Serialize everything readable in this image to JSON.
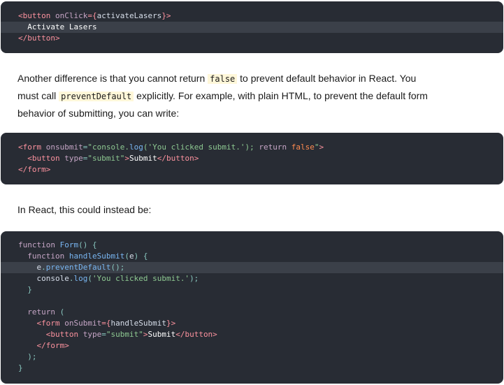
{
  "block1": {
    "lines": [
      [
        [
          "tok-tag",
          "<button "
        ],
        [
          "tok-attr",
          "onClick"
        ],
        [
          "tok-tag",
          "={"
        ],
        [
          "tok-var",
          "activateLasers"
        ],
        [
          "tok-tag",
          "}>"
        ]
      ],
      [
        [
          "tok-text",
          "  Activate Lasers"
        ]
      ],
      [
        [
          "tok-tag",
          "</button>"
        ]
      ]
    ]
  },
  "para1": {
    "t1": "Another difference is that you cannot return ",
    "c1": "false",
    "t2": " to prevent default behavior in React. You must call ",
    "c2": "preventDefault",
    "t3": " explicitly. For example, with plain HTML, to prevent the default form behavior of submitting, you can write:"
  },
  "block2": {
    "lines": [
      [
        [
          "tok-tag",
          "<form "
        ],
        [
          "tok-attr",
          "onsubmit"
        ],
        [
          "tok-punct",
          "="
        ],
        [
          "tok-str",
          "\"console."
        ],
        [
          "tok-fn",
          "log"
        ],
        [
          "tok-str",
          "('You clicked submit.'); "
        ],
        [
          "tok-kw",
          "return "
        ],
        [
          "tok-bool",
          "false"
        ],
        [
          "tok-str",
          "\""
        ],
        [
          "tok-tag",
          ">"
        ]
      ],
      [
        [
          "tok-tag",
          "  <button "
        ],
        [
          "tok-attr",
          "type"
        ],
        [
          "tok-punct",
          "="
        ],
        [
          "tok-str",
          "\"submit\""
        ],
        [
          "tok-tag",
          ">"
        ],
        [
          "tok-text",
          "Submit"
        ],
        [
          "tok-tag",
          "</button>"
        ]
      ],
      [
        [
          "tok-tag",
          "</form>"
        ]
      ]
    ]
  },
  "para2": {
    "text": "In React, this could instead be:"
  },
  "block3": {
    "lines": [
      [
        [
          "tok-kw",
          "function "
        ],
        [
          "tok-fn",
          "Form"
        ],
        [
          "tok-punct",
          "() {"
        ]
      ],
      [
        [
          "tok-kw",
          "  function "
        ],
        [
          "tok-fn",
          "handleSubmit"
        ],
        [
          "tok-punct",
          "("
        ],
        [
          "tok-var",
          "e"
        ],
        [
          "tok-punct",
          ") {"
        ]
      ],
      [
        [
          "tok-var",
          "    e"
        ],
        [
          "tok-punct",
          "."
        ],
        [
          "tok-fn",
          "preventDefault"
        ],
        [
          "tok-punct",
          "();"
        ]
      ],
      [
        [
          "tok-var",
          "    console"
        ],
        [
          "tok-punct",
          "."
        ],
        [
          "tok-fn",
          "log"
        ],
        [
          "tok-punct",
          "("
        ],
        [
          "tok-str",
          "'You clicked submit.'"
        ],
        [
          "tok-punct",
          ");"
        ]
      ],
      [
        [
          "tok-punct",
          "  }"
        ]
      ],
      [
        [
          "tok-text",
          ""
        ]
      ],
      [
        [
          "tok-kw",
          "  return "
        ],
        [
          "tok-punct",
          "("
        ]
      ],
      [
        [
          "tok-tag",
          "    <form "
        ],
        [
          "tok-attr",
          "onSubmit"
        ],
        [
          "tok-tag",
          "={"
        ],
        [
          "tok-var",
          "handleSubmit"
        ],
        [
          "tok-tag",
          "}>"
        ]
      ],
      [
        [
          "tok-tag",
          "      <button "
        ],
        [
          "tok-attr",
          "type"
        ],
        [
          "tok-punct",
          "="
        ],
        [
          "tok-str",
          "\"submit\""
        ],
        [
          "tok-tag",
          ">"
        ],
        [
          "tok-text",
          "Submit"
        ],
        [
          "tok-tag",
          "</button>"
        ]
      ],
      [
        [
          "tok-tag",
          "    </form>"
        ]
      ],
      [
        [
          "tok-punct",
          "  );"
        ]
      ],
      [
        [
          "tok-punct",
          "}"
        ]
      ]
    ]
  }
}
